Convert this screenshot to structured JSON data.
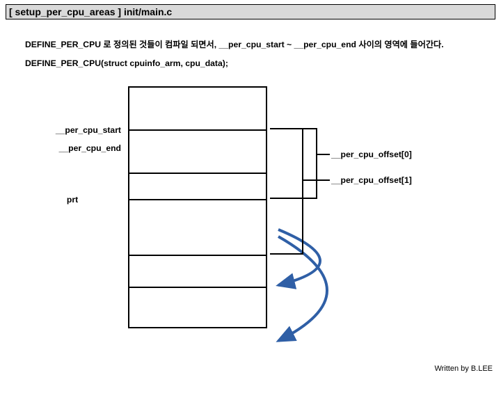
{
  "title": "[ setup_per_cpu_areas ] init/main.c",
  "text": {
    "line1": "DEFINE_PER_CPU 로 정의된 것들이 컴파일 되면서, __per_cpu_start ~ __per_cpu_end 사이의 영역에 들어간다.",
    "line2": "DEFINE_PER_CPU(struct cpuinfo_arm, cpu_data);"
  },
  "labels": {
    "per_cpu_start": "__per_cpu_start",
    "per_cpu_end": "__per_cpu_end",
    "prt": "prt",
    "offset0": "__per_cpu_offset[0]",
    "offset1": "__per_cpu_offset[1]"
  },
  "footer": "Written by B.LEE",
  "colors": {
    "arrow": "#2f5fa6"
  }
}
